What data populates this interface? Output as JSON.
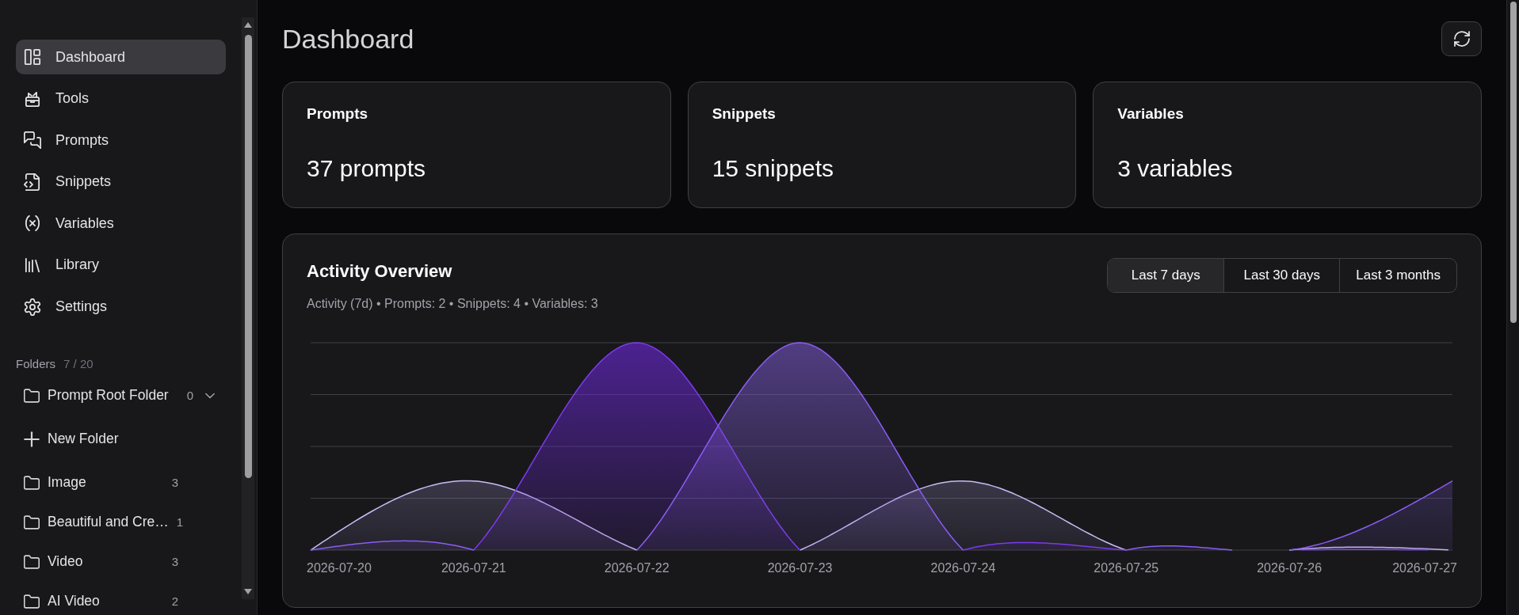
{
  "sidebar": {
    "nav_items": [
      {
        "kind": "dashboard",
        "label": "Dashboard",
        "selected": true
      },
      {
        "kind": "tools",
        "label": "Tools",
        "selected": false
      },
      {
        "kind": "prompts",
        "label": "Prompts",
        "selected": false
      },
      {
        "kind": "snippets",
        "label": "Snippets",
        "selected": false
      },
      {
        "kind": "variables",
        "label": "Variables",
        "selected": false
      },
      {
        "kind": "library",
        "label": "Library",
        "selected": false
      },
      {
        "kind": "settings",
        "label": "Settings",
        "selected": false
      }
    ],
    "folders": {
      "label": "Folders",
      "count": "7 / 20",
      "items": [
        {
          "kind": "root",
          "name": "Prompt Root Folder",
          "count": "0"
        },
        {
          "kind": "action",
          "name": "New Folder"
        },
        {
          "kind": "folder",
          "name": "Image",
          "count": "3"
        },
        {
          "kind": "folder",
          "name": "Beautiful and Cre…",
          "count": "1"
        },
        {
          "kind": "folder",
          "name": "Video",
          "count": "3"
        },
        {
          "kind": "folder",
          "name": "AI Video",
          "count": "2"
        }
      ]
    }
  },
  "header": {
    "title": "Dashboard"
  },
  "stat_cards": [
    {
      "title": "Prompts",
      "value": "37 prompts"
    },
    {
      "title": "Snippets",
      "value": "15 snippets"
    },
    {
      "title": "Variables",
      "value": "3 variables"
    }
  ],
  "activity": {
    "title": "Activity Overview",
    "summary": "Activity (7d) • Prompts: 2 • Snippets: 4 • Variables: 3",
    "ranges": [
      {
        "label": "Last 7 days",
        "selected": true
      },
      {
        "label": "Last 30 days",
        "selected": false
      },
      {
        "label": "Last 3 months",
        "selected": false
      }
    ],
    "x_labels": [
      "2026-07-20",
      "2026-07-21",
      "2026-07-22",
      "2026-07-23",
      "2026-07-24",
      "2026-07-25",
      "2026-07-26",
      "2026-07-27"
    ]
  }
}
